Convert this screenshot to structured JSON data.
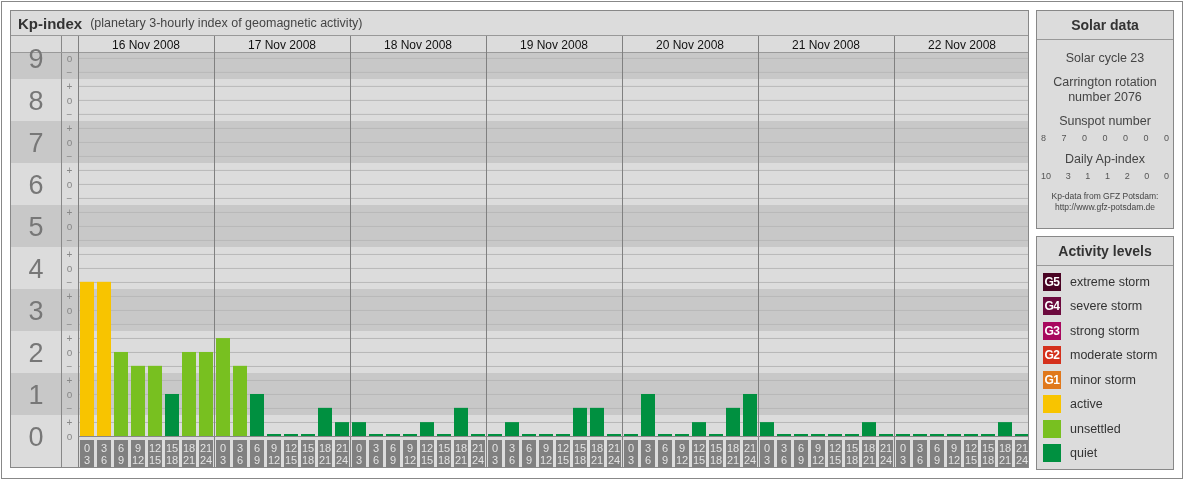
{
  "kp_panel": {
    "title": "Kp-index",
    "subtitle": "(planetary 3-hourly index of geomagnetic activity)",
    "days": [
      "16 Nov 2008",
      "17 Nov 2008",
      "18 Nov 2008",
      "19 Nov 2008",
      "20 Nov 2008",
      "21 Nov 2008",
      "22 Nov 2008"
    ],
    "minor_tick_labels": [
      "o",
      "−",
      "+",
      "o",
      "−",
      "+",
      "o",
      "−",
      "+",
      "o",
      "−",
      "+",
      "o",
      "−",
      "+",
      "o",
      "−",
      "+",
      "o",
      "−",
      "+",
      "o",
      "−",
      "+",
      "o",
      "−",
      "+",
      "o"
    ],
    "chart_data": {
      "type": "bar",
      "ylim": [
        0,
        9.14
      ],
      "yticks": [
        0,
        1,
        2,
        3,
        4,
        5,
        6,
        7,
        8,
        9
      ],
      "grid": true,
      "categories": [
        "0\n3",
        "3\n6",
        "6\n9",
        "9\n12",
        "12\n15",
        "15\n18",
        "18\n21",
        "21\n24",
        "0\n3",
        "3\n6",
        "6\n9",
        "9\n12",
        "12\n15",
        "15\n18",
        "18\n21",
        "21\n24",
        "0\n3",
        "3\n6",
        "6\n9",
        "9\n12",
        "12\n15",
        "15\n18",
        "18\n21",
        "21\n24",
        "0\n3",
        "3\n6",
        "6\n9",
        "9\n12",
        "12\n15",
        "15\n18",
        "18\n21",
        "21\n24",
        "0\n3",
        "3\n6",
        "6\n9",
        "9\n12",
        "12\n15",
        "15\n18",
        "18\n21",
        "21\n24",
        "0\n3",
        "3\n6",
        "6\n9",
        "9\n12",
        "12\n15",
        "15\n18",
        "18\n21",
        "21\n24",
        "0\n3",
        "3\n6",
        "6\n9",
        "9\n12",
        "12\n15",
        "15\n18",
        "18\n21",
        "21\n24"
      ],
      "values": [
        3.67,
        3.67,
        2,
        1.67,
        1.67,
        1,
        2,
        2,
        2.33,
        1.67,
        1,
        0,
        0,
        0,
        0.67,
        0.33,
        0.33,
        0,
        0,
        0,
        0.33,
        0,
        0.67,
        0,
        0,
        0.33,
        0,
        0,
        0,
        0.67,
        0.67,
        0,
        0,
        1,
        0,
        0,
        0.33,
        0,
        0.67,
        1,
        0.33,
        0,
        0,
        0,
        0,
        0,
        0.33,
        0,
        0,
        0,
        0,
        0,
        0,
        0,
        0.33,
        0
      ]
    }
  },
  "solar_data": {
    "title": "Solar data",
    "cycle": "Solar cycle 23",
    "rotation": "Carrington rotation number 2076",
    "sunspot_label": "Sunspot number",
    "sunspot_numbers": [
      "8",
      "7",
      "0",
      "0",
      "0",
      "0",
      "0"
    ],
    "ap_label": "Daily Ap-index",
    "ap_numbers": [
      "10",
      "3",
      "1",
      "1",
      "2",
      "0",
      "0"
    ],
    "source": "Kp-data from GFZ Potsdam: http://www.gfz-potsdam.de"
  },
  "activity_levels": {
    "title": "Activity levels",
    "items": [
      {
        "badge": "G5",
        "label": "extreme storm",
        "color": "#4a0424"
      },
      {
        "badge": "G4",
        "label": "severe storm",
        "color": "#6c0a3e"
      },
      {
        "badge": "G3",
        "label": "strong storm",
        "color": "#a8085e"
      },
      {
        "badge": "G2",
        "label": "moderate storm",
        "color": "#d4301c"
      },
      {
        "badge": "G1",
        "label": "minor storm",
        "color": "#e0781c"
      },
      {
        "label": "active",
        "color": "#f8c400"
      },
      {
        "label": "unsettled",
        "color": "#78c020"
      },
      {
        "label": "quiet",
        "color": "#009040"
      }
    ]
  }
}
